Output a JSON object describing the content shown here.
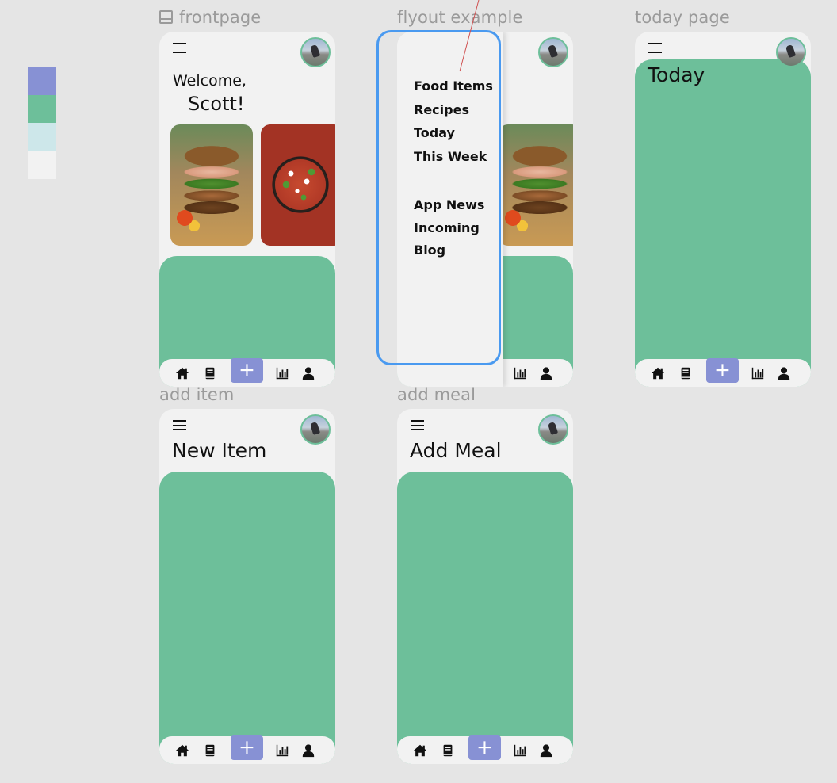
{
  "palette": [
    "#8791d4",
    "#6dbf9a",
    "#cde7ea",
    "#f2f2f2"
  ],
  "frames": {
    "frontpage": {
      "label": "frontpage",
      "greeting": "Welcome,",
      "user_name": "Scott!"
    },
    "flyout": {
      "label": "flyout example",
      "menu_primary": [
        "Food Items",
        "Recipes",
        "Today",
        "This Week"
      ],
      "menu_secondary": [
        "App News",
        "Incoming",
        "Blog"
      ]
    },
    "today": {
      "label": "today page",
      "heading": "Today"
    },
    "add_item": {
      "label": "add item",
      "heading": "New Item"
    },
    "add_meal": {
      "label": "add meal",
      "heading": "Add Meal"
    }
  },
  "nav": {
    "add_label": "+",
    "icons": [
      "home-icon",
      "book-icon",
      "add-icon",
      "chart-icon",
      "user-icon"
    ]
  }
}
